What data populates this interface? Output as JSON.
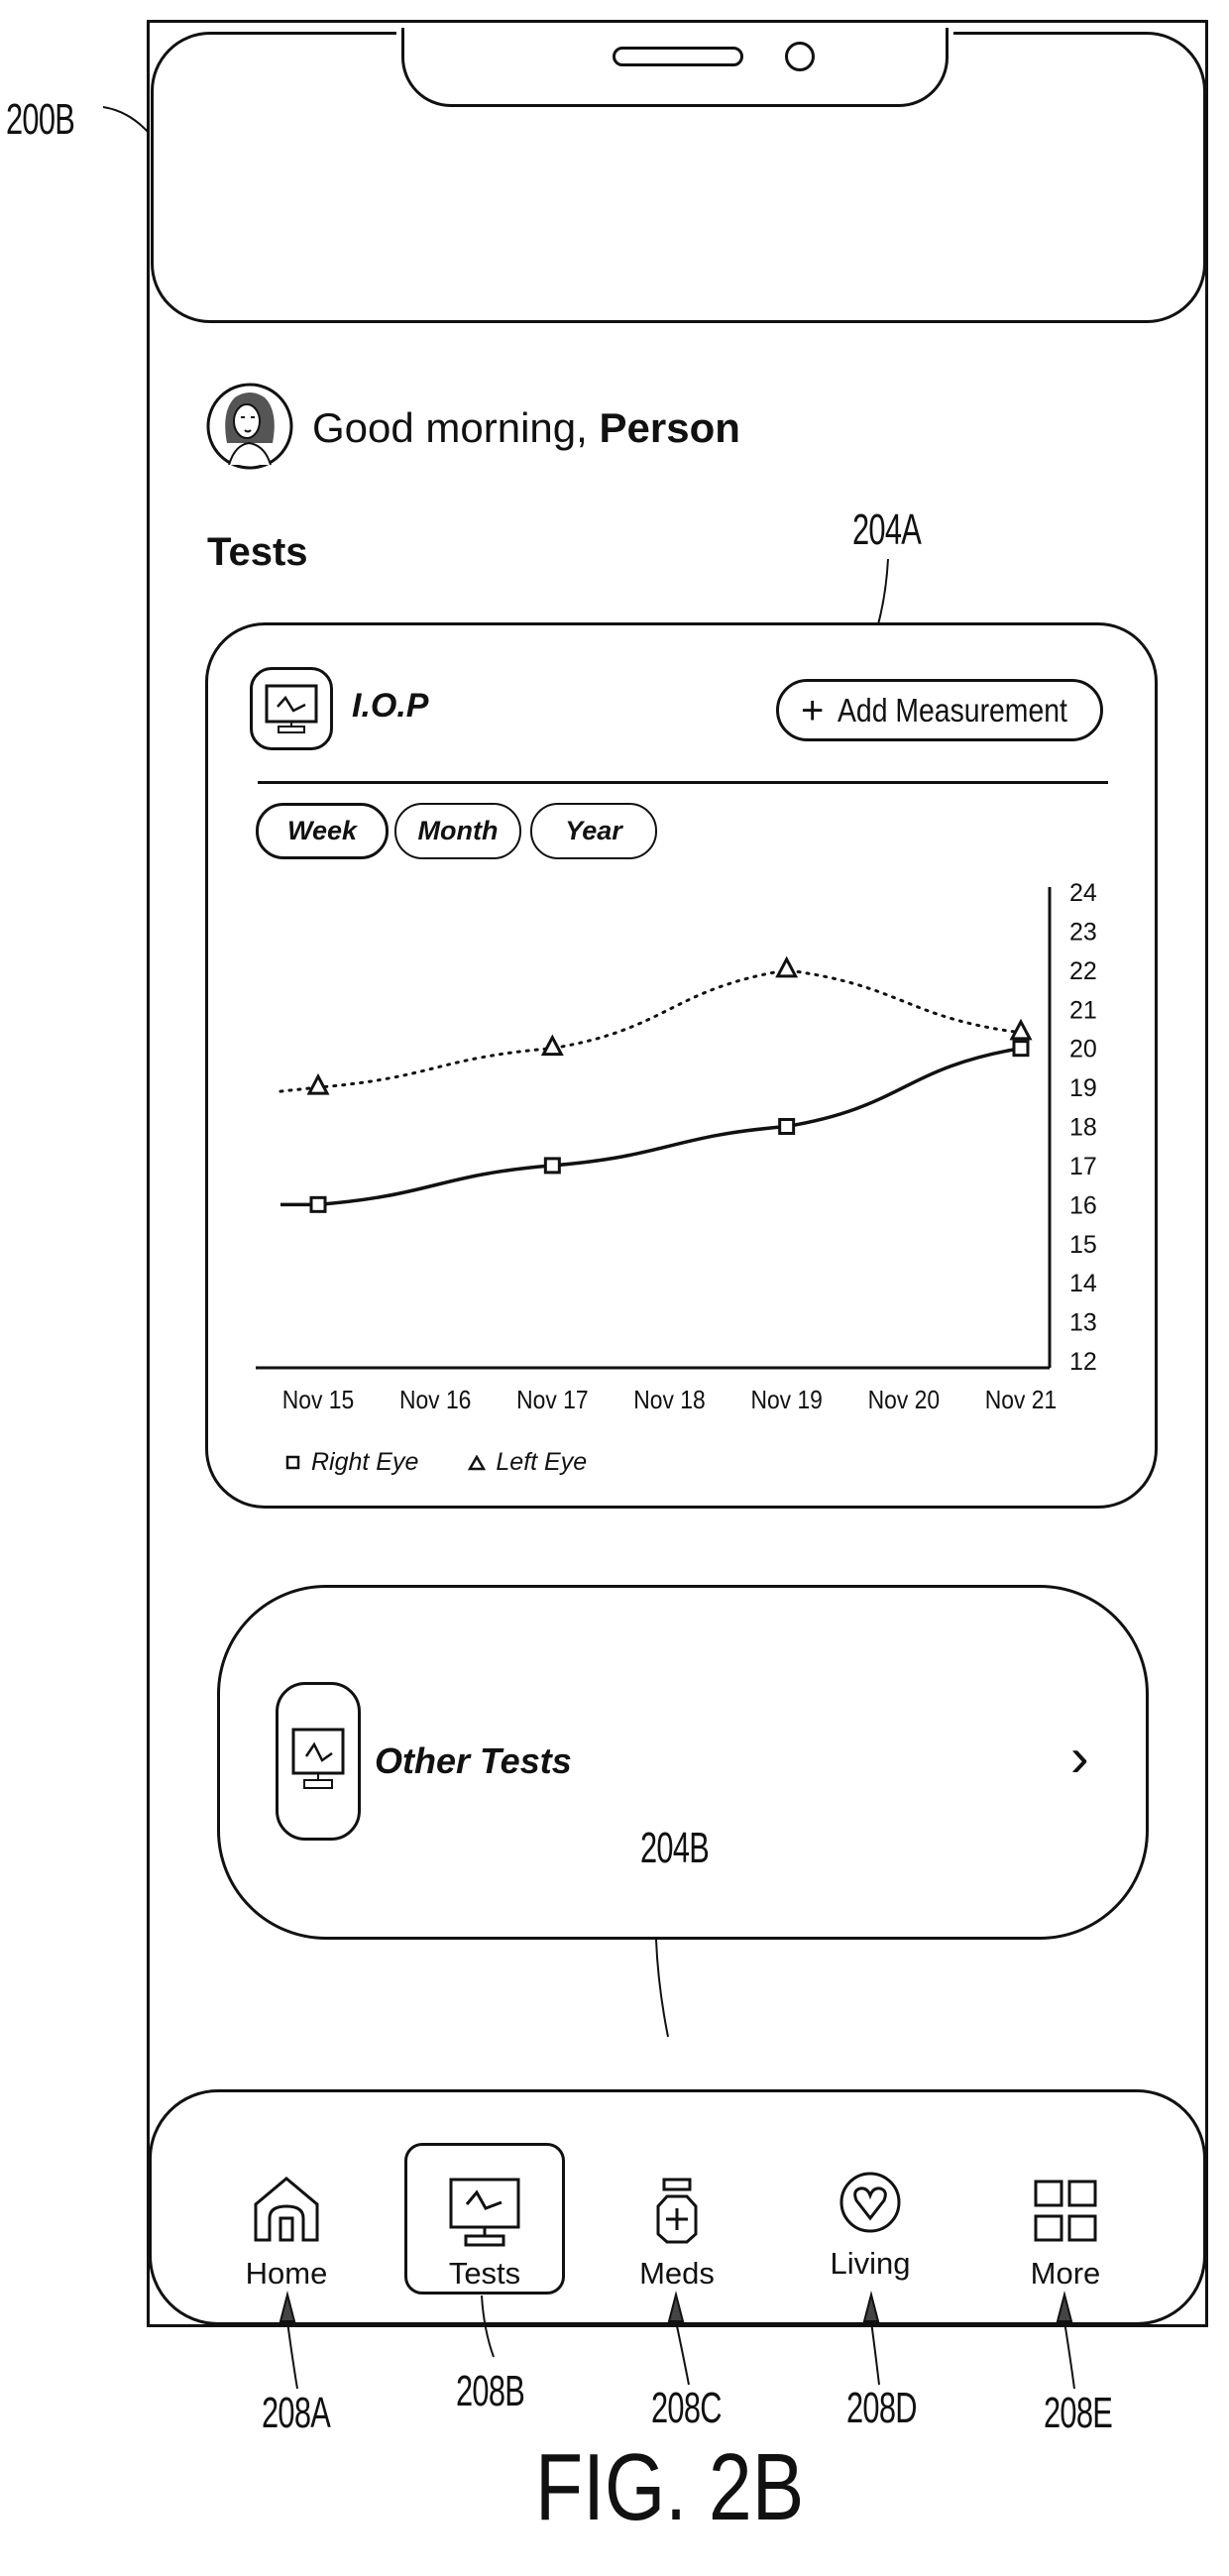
{
  "figure": {
    "caption": "FIG. 2B",
    "refs": {
      "device": "200B",
      "iop_card": "204A",
      "other_tests_card": "204B",
      "nav_home": "208A",
      "nav_tests": "208B",
      "nav_meds": "208C",
      "nav_living": "208D",
      "nav_more": "208E"
    }
  },
  "header": {
    "greeting_prefix": "Good morning, ",
    "user_name": "Person",
    "avatar_icon": "person-avatar"
  },
  "section": {
    "title": "Tests"
  },
  "iop_card": {
    "icon": "monitor-chart-icon",
    "title": "I.O.P",
    "add_button": {
      "icon": "plus",
      "label": "Add Measurement"
    },
    "ranges": [
      {
        "label": "Week",
        "active": true
      },
      {
        "label": "Month",
        "active": false
      },
      {
        "label": "Year",
        "active": false
      }
    ]
  },
  "chart_data": {
    "type": "line",
    "title": "I.O.P",
    "xlabel": "",
    "ylabel": "",
    "categories": [
      "Nov 15",
      "Nov 16",
      "Nov 17",
      "Nov 18",
      "Nov 19",
      "Nov 20",
      "Nov 21"
    ],
    "series": [
      {
        "name": "Right Eye",
        "marker": "square",
        "line_style": "solid",
        "values": [
          16,
          null,
          17,
          null,
          18,
          null,
          20
        ]
      },
      {
        "name": "Left Eye",
        "marker": "triangle",
        "line_style": "dotted",
        "values": [
          19,
          null,
          20,
          null,
          22,
          null,
          20.4
        ]
      }
    ],
    "yticks": [
      24,
      23,
      22,
      21,
      20,
      19,
      18,
      17,
      16,
      15,
      14,
      13,
      12
    ],
    "ylim": [
      12,
      24
    ],
    "y_axis_side": "right",
    "grid": false,
    "legend": "bottom-left"
  },
  "other_tests": {
    "icon": "monitor-chart-icon",
    "title": "Other Tests",
    "chevron": "›"
  },
  "nav": {
    "items": [
      {
        "id": "home",
        "label": "Home",
        "icon": "home-icon",
        "active": false
      },
      {
        "id": "tests",
        "label": "Tests",
        "icon": "monitor-chart-icon",
        "active": true
      },
      {
        "id": "meds",
        "label": "Meds",
        "icon": "medicine-bottle-icon",
        "active": false
      },
      {
        "id": "living",
        "label": "Living",
        "icon": "heart-circle-icon",
        "active": false
      },
      {
        "id": "more",
        "label": "More",
        "icon": "grid-icon",
        "active": false
      }
    ]
  }
}
